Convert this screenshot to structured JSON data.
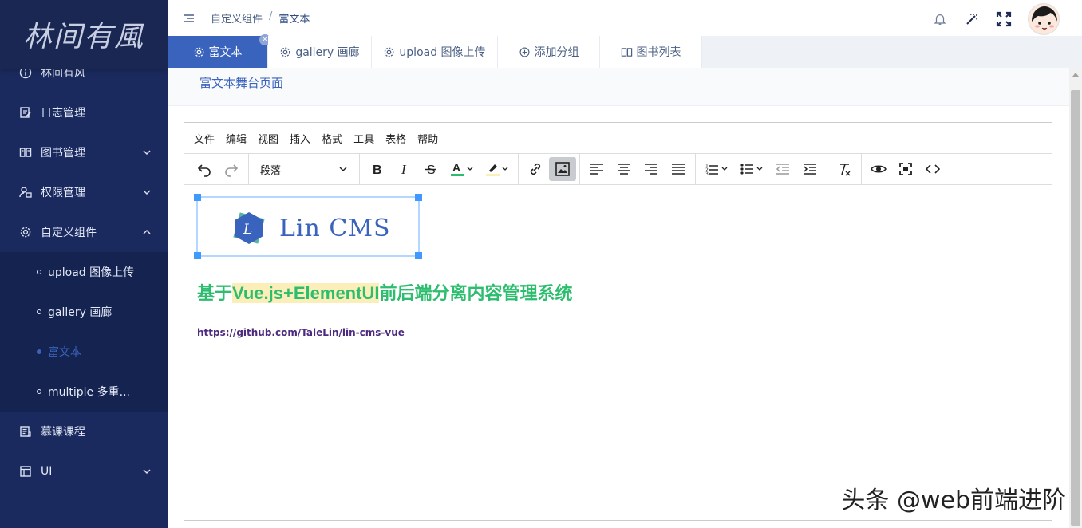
{
  "sidebar": {
    "logo": "林间有風",
    "items": [
      {
        "label": "林间有风"
      },
      {
        "label": "日志管理"
      },
      {
        "label": "图书管理"
      },
      {
        "label": "权限管理"
      },
      {
        "label": "自定义组件"
      },
      {
        "label": "慕课课程"
      },
      {
        "label": "UI"
      }
    ],
    "sub_items": [
      {
        "label": "upload 图像上传"
      },
      {
        "label": "gallery 画廊"
      },
      {
        "label": "富文本"
      },
      {
        "label": "multiple 多重..."
      }
    ]
  },
  "header": {
    "breadcrumb": [
      "自定义组件",
      "/",
      "富文本"
    ]
  },
  "tabs": [
    {
      "label": "富文本",
      "active": true
    },
    {
      "label": "gallery 画廊"
    },
    {
      "label": "upload 图像上传"
    },
    {
      "label": "添加分组"
    },
    {
      "label": "图书列表"
    }
  ],
  "page": {
    "title": "富文本舞台页面"
  },
  "editor": {
    "menubar": [
      "文件",
      "编辑",
      "视图",
      "插入",
      "格式",
      "工具",
      "表格",
      "帮助"
    ],
    "block_format": "段落",
    "image_text": "Lin CMS",
    "image_logo_letter": "L",
    "headline_pre": "基于",
    "headline_highlight": "Vue.js+ElementUI",
    "headline_post": "前后端分离内容管理系统",
    "link": "https://github.com/TaleLin/lin-cms-vue",
    "text_color": "#2dbd6e",
    "highlight_color": "#fbeeb8"
  },
  "watermark": "头条 @web前端进阶",
  "colors": {
    "sidebar_bg": "#1a2a5e",
    "accent": "#3963bc"
  }
}
